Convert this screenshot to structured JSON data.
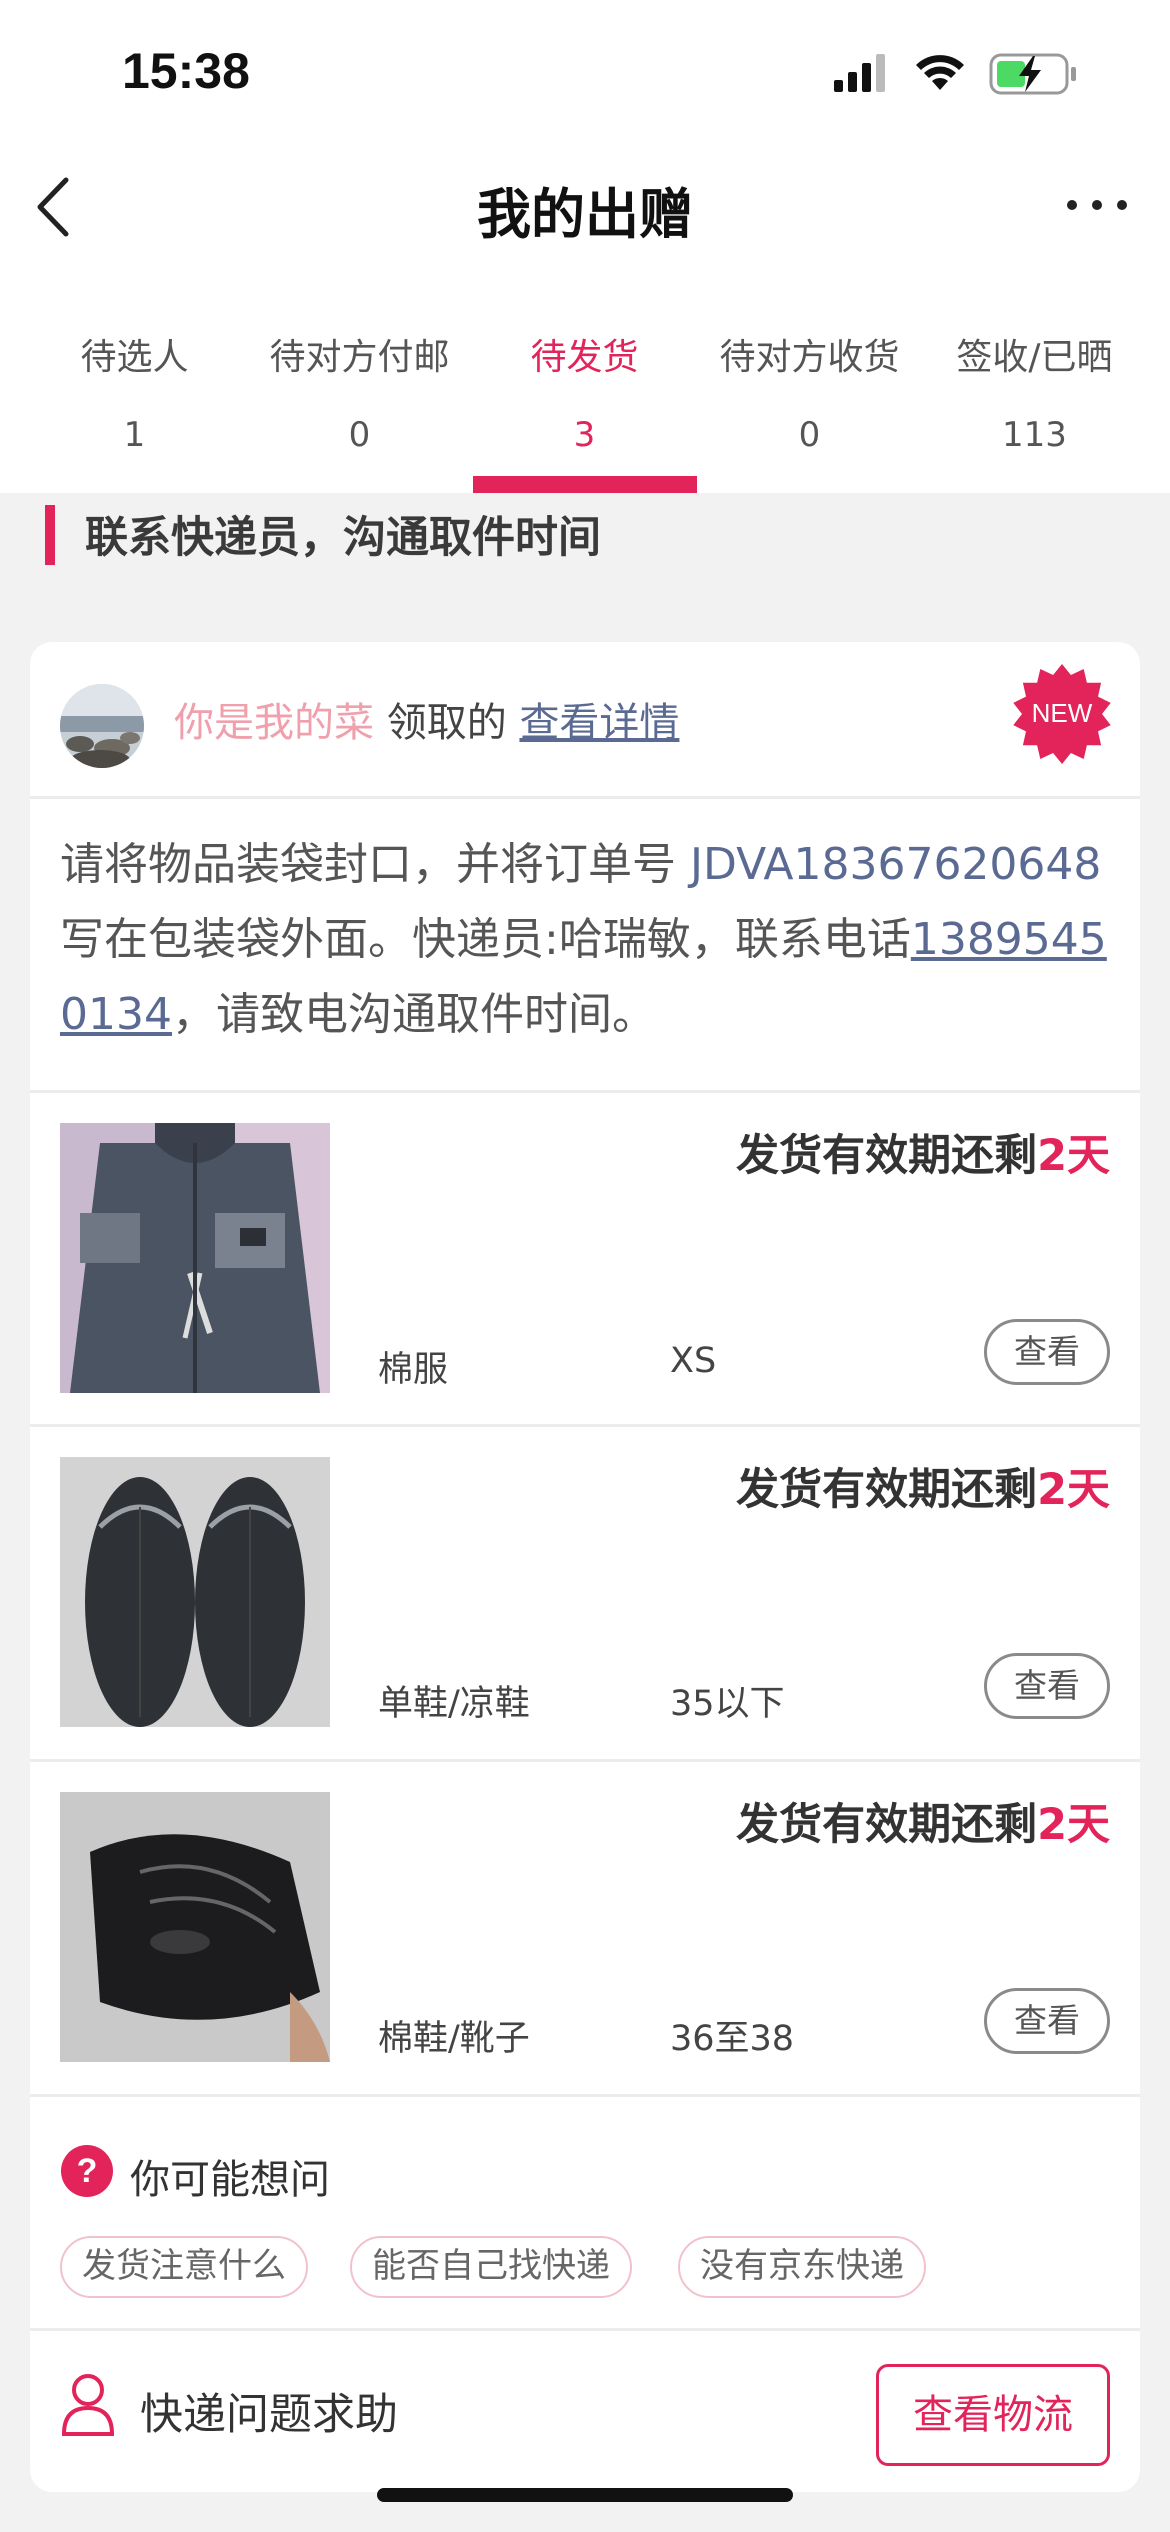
{
  "status_bar": {
    "time": "15:38"
  },
  "nav": {
    "title": "我的出赠"
  },
  "tabs": [
    {
      "label": "待选人",
      "count": "1"
    },
    {
      "label": "待对方付邮",
      "count": "0"
    },
    {
      "label": "待发货",
      "count": "3"
    },
    {
      "label": "待对方收货",
      "count": "0"
    },
    {
      "label": "签收/已晒",
      "count": "113"
    }
  ],
  "active_tab": "待发货",
  "section_title": "联系快递员，沟通取件时间",
  "card": {
    "receiver_name": "你是我的菜",
    "receiver_action": " 领取的 ",
    "detail_link": "查看详情",
    "badge": "NEW",
    "instructions": {
      "part1": "请将物品装袋封口，并将订单号 ",
      "order_no": "JDVA18367620648",
      "part2": " 写在包装袋外面。快递员:哈瑞敏，联系电话",
      "phone": "13895450134",
      "part3": "，请致电沟通取件时间。"
    },
    "items": [
      {
        "deadline_prefix": "发货有效期还剩",
        "deadline_days": "2天",
        "category": "棉服",
        "size": "XS",
        "button": "查看",
        "icon": "jacket-photo"
      },
      {
        "deadline_prefix": "发货有效期还剩",
        "deadline_days": "2天",
        "category": "单鞋/凉鞋",
        "size": "35以下",
        "button": "查看",
        "icon": "flip-flops-photo"
      },
      {
        "deadline_prefix": "发货有效期还剩",
        "deadline_days": "2天",
        "category": "棉鞋/靴子",
        "size": "36至38",
        "button": "查看",
        "icon": "boots-photo"
      }
    ],
    "faq": {
      "title": "你可能想问",
      "chips": [
        "发货注意什么",
        "能否自己找快递",
        "没有京东快递"
      ]
    },
    "footer": {
      "help_text": "快递问题求助",
      "track_button": "查看物流"
    }
  },
  "colors": {
    "accent": "#e2245b",
    "link": "#5a6a93",
    "receiver": "#f0a0ac"
  }
}
